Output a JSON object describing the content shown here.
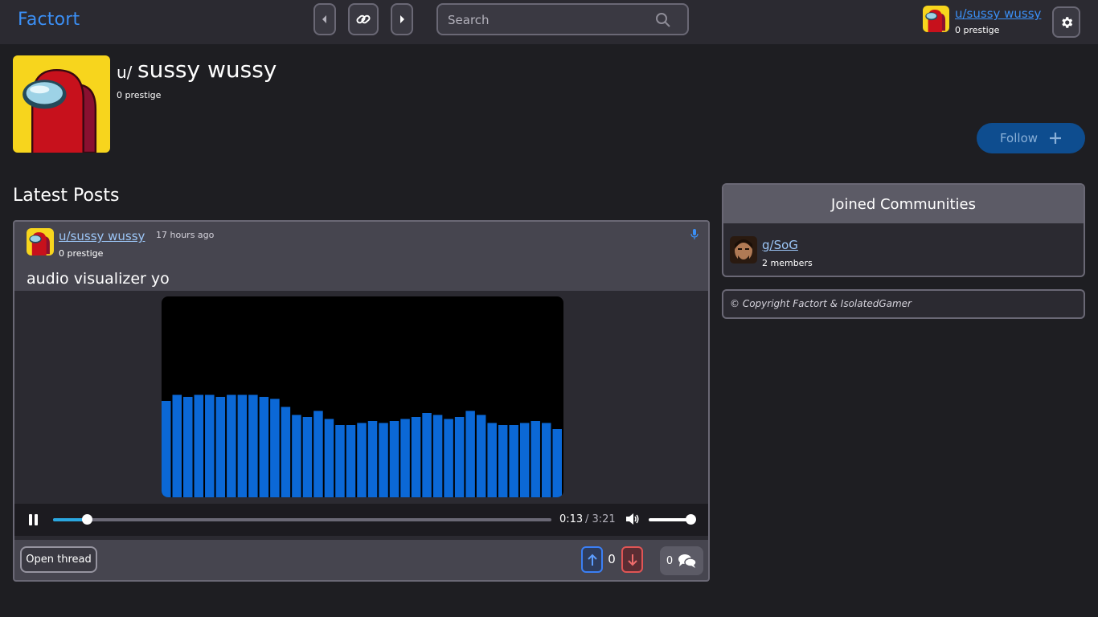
{
  "brand": "Factort",
  "nav": {
    "back_icon": "chevron-left-icon",
    "link_icon": "link-icon",
    "forward_icon": "chevron-right-icon"
  },
  "search": {
    "placeholder": "Search"
  },
  "current_user": {
    "username": "u/sussy wussy",
    "prestige": "0 prestige"
  },
  "profile": {
    "prefix": "u/",
    "name": "sussy wussy",
    "prestige": "0 prestige",
    "follow_label": "Follow"
  },
  "section_title": "Latest Posts",
  "post": {
    "author": "u/sussy wussy",
    "time": "17 hours ago",
    "prestige": "0 prestige",
    "title": "audio visualizer yo",
    "player": {
      "current": "0:13",
      "separator_duration": "/ 3:21",
      "progress": 0.068,
      "volume": 1.0,
      "visualizer_levels": [
        0.48,
        0.51,
        0.5,
        0.51,
        0.51,
        0.5,
        0.51,
        0.51,
        0.51,
        0.5,
        0.49,
        0.45,
        0.41,
        0.4,
        0.43,
        0.39,
        0.36,
        0.36,
        0.37,
        0.38,
        0.37,
        0.38,
        0.39,
        0.4,
        0.42,
        0.41,
        0.39,
        0.4,
        0.43,
        0.41,
        0.37,
        0.36,
        0.36,
        0.37,
        0.38,
        0.37,
        0.34
      ]
    },
    "open_thread_label": "Open thread",
    "votes": "0",
    "comments": "0"
  },
  "sidebar": {
    "communities_title": "Joined Communities",
    "communities": [
      {
        "name": "g/SoG",
        "members": "2 members"
      }
    ],
    "copyright": "© Copyright Factort & IsolatedGamer"
  },
  "colors": {
    "accent": "#3b8ff5",
    "bar": "#0b68d6",
    "upvote": "#3b7ff5",
    "downvote": "#e05555"
  }
}
